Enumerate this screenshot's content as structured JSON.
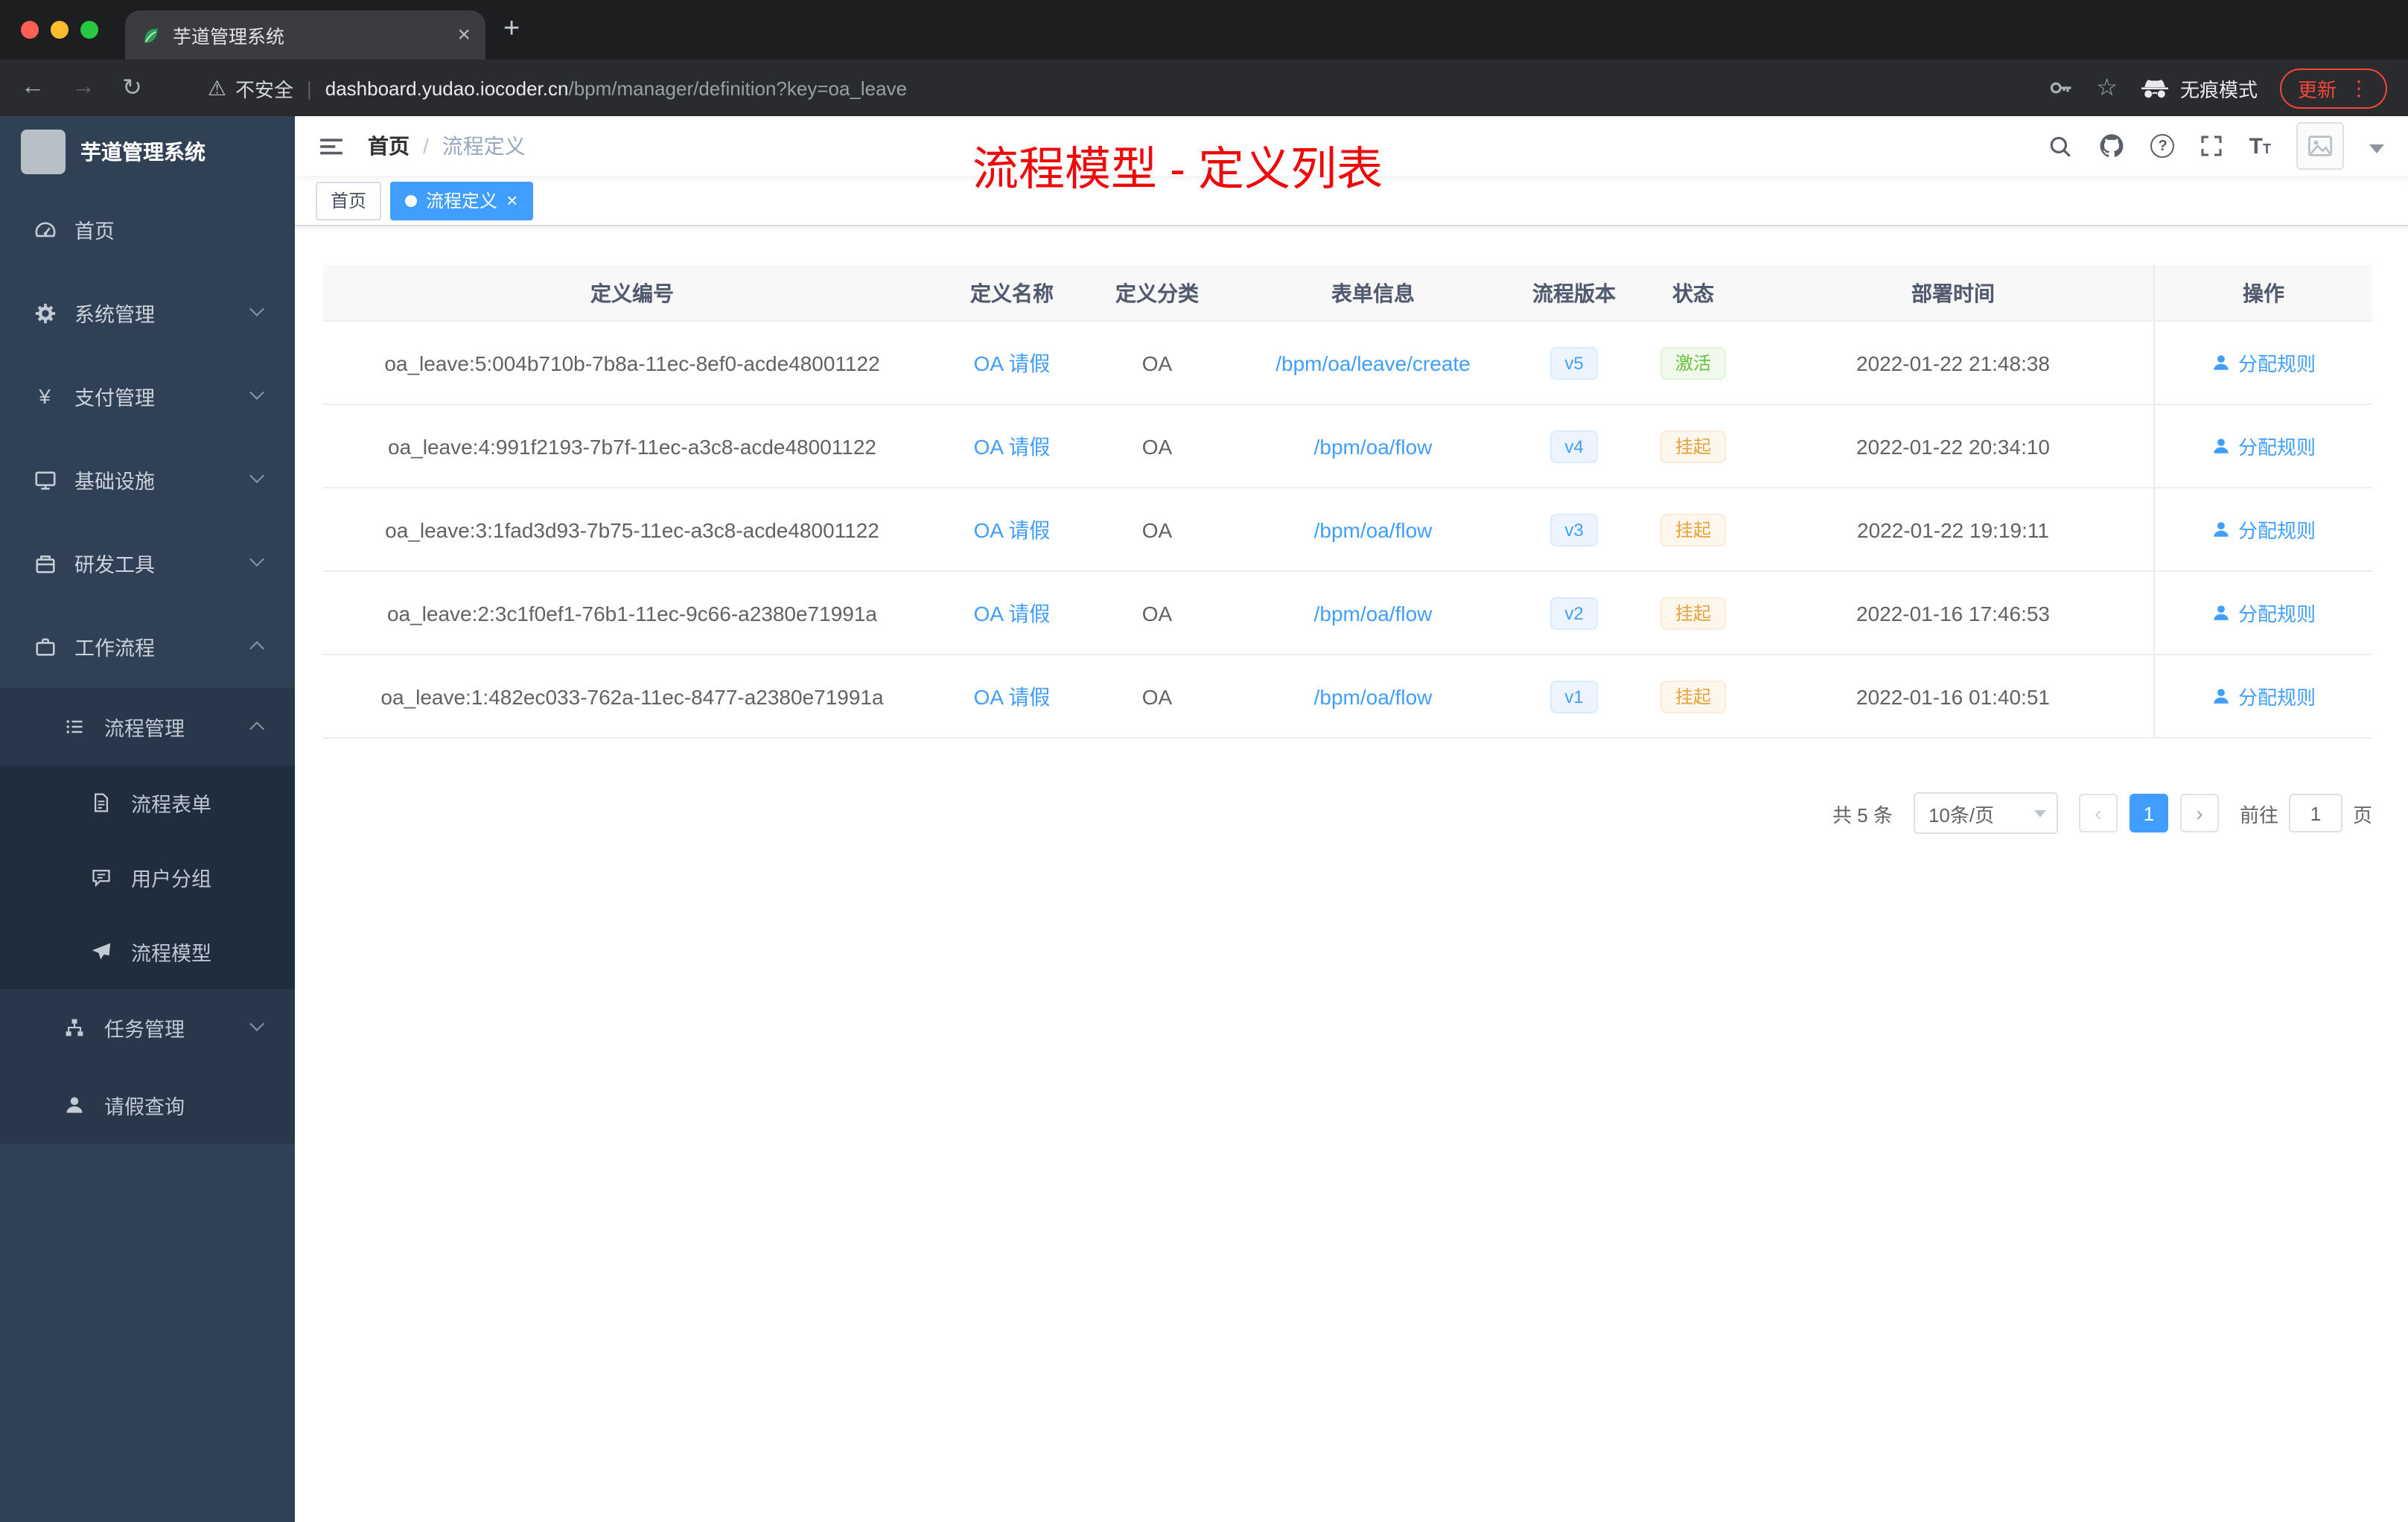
{
  "browser": {
    "tab_title": "芋道管理系统",
    "security_text": "不安全",
    "url_domain": "dashboard.yudao.iocoder.cn",
    "url_path": "/bpm/manager/definition?key=oa_leave",
    "incognito_label": "无痕模式",
    "update_label": "更新"
  },
  "icons": {
    "close": "×",
    "plus": "+",
    "back": "←",
    "forward": "→",
    "reload": "↻",
    "warning": "⚠",
    "star": "☆",
    "menu_dots": "⋮",
    "question": "?",
    "prev": "‹",
    "next": "›",
    "font_large": "T",
    "font_small": "T",
    "yen": "¥",
    "breadcrumb_separator": "/",
    "url_separator": "|"
  },
  "sidebar": {
    "logo_title": "芋道管理系统",
    "items": [
      {
        "label": "首页"
      },
      {
        "label": "系统管理"
      },
      {
        "label": "支付管理"
      },
      {
        "label": "基础设施"
      },
      {
        "label": "研发工具"
      },
      {
        "label": "工作流程"
      },
      {
        "label": "流程管理"
      },
      {
        "label": "流程表单"
      },
      {
        "label": "用户分组"
      },
      {
        "label": "流程模型"
      },
      {
        "label": "任务管理"
      },
      {
        "label": "请假查询"
      }
    ]
  },
  "header": {
    "breadcrumb": [
      "首页",
      "流程定义"
    ],
    "annotation": "流程模型 - 定义列表"
  },
  "tags": {
    "home": "首页",
    "active": "流程定义"
  },
  "table": {
    "columns": [
      "定义编号",
      "定义名称",
      "定义分类",
      "表单信息",
      "流程版本",
      "状态",
      "部署时间",
      "操作"
    ],
    "action_label": "分配规则",
    "rows": [
      {
        "id": "oa_leave:5:004b710b-7b8a-11ec-8ef0-acde48001122",
        "name": "OA 请假",
        "category": "OA",
        "form": "/bpm/oa/leave/create",
        "version": "v5",
        "status": "激活",
        "status_type": "success",
        "time": "2022-01-22 21:48:38"
      },
      {
        "id": "oa_leave:4:991f2193-7b7f-11ec-a3c8-acde48001122",
        "name": "OA 请假",
        "category": "OA",
        "form": "/bpm/oa/flow",
        "version": "v4",
        "status": "挂起",
        "status_type": "warning",
        "time": "2022-01-22 20:34:10"
      },
      {
        "id": "oa_leave:3:1fad3d93-7b75-11ec-a3c8-acde48001122",
        "name": "OA 请假",
        "category": "OA",
        "form": "/bpm/oa/flow",
        "version": "v3",
        "status": "挂起",
        "status_type": "warning",
        "time": "2022-01-22 19:19:11"
      },
      {
        "id": "oa_leave:2:3c1f0ef1-76b1-11ec-9c66-a2380e71991a",
        "name": "OA 请假",
        "category": "OA",
        "form": "/bpm/oa/flow",
        "version": "v2",
        "status": "挂起",
        "status_type": "warning",
        "time": "2022-01-16 17:46:53"
      },
      {
        "id": "oa_leave:1:482ec033-762a-11ec-8477-a2380e71991a",
        "name": "OA 请假",
        "category": "OA",
        "form": "/bpm/oa/flow",
        "version": "v1",
        "status": "挂起",
        "status_type": "warning",
        "time": "2022-01-16 01:40:51"
      }
    ]
  },
  "pagination": {
    "total": "共 5 条",
    "page_size": "10条/页",
    "current_page": "1",
    "goto_label": "前往",
    "goto_value": "1",
    "goto_unit": "页"
  },
  "colors": {
    "accent": "#409eff",
    "success": "#67c23a",
    "warning": "#e6a23c",
    "annotation": "#ee0a0a",
    "sidebar": "#304156"
  }
}
